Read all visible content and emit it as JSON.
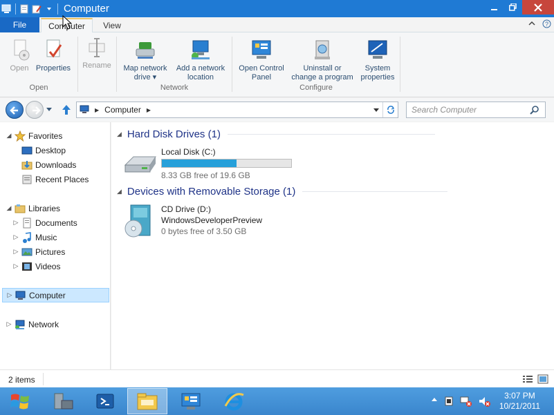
{
  "window": {
    "title": "Computer"
  },
  "tabs": {
    "file": "File",
    "computer": "Computer",
    "view": "View"
  },
  "ribbon": {
    "open": "Open",
    "properties": "Properties",
    "rename": "Rename",
    "map_drive_line1": "Map network",
    "map_drive_line2": "drive ▾",
    "add_location_line1": "Add a network",
    "add_location_line2": "location",
    "control_panel_line1": "Open Control",
    "control_panel_line2": "Panel",
    "uninstall_line1": "Uninstall or",
    "uninstall_line2": "change a program",
    "system_props_line1": "System",
    "system_props_line2": "properties",
    "group_open": "Open",
    "group_network": "Network",
    "group_configure": "Configure"
  },
  "address": {
    "crumb": "Computer",
    "search_placeholder": "Search Computer"
  },
  "nav": {
    "favorites": "Favorites",
    "desktop": "Desktop",
    "downloads": "Downloads",
    "recent": "Recent Places",
    "libraries": "Libraries",
    "documents": "Documents",
    "music": "Music",
    "pictures": "Pictures",
    "videos": "Videos",
    "computer": "Computer",
    "network": "Network"
  },
  "content": {
    "hdd_group": "Hard Disk Drives (1)",
    "removable_group": "Devices with Removable Storage (1)",
    "local_disk": {
      "name": "Local Disk (C:)",
      "free": "8.33 GB free of 19.6 GB",
      "used_fraction": 0.575
    },
    "cd_drive": {
      "name": "CD Drive (D:)",
      "label": "WindowsDeveloperPreview",
      "free": "0 bytes free of 3.50 GB"
    }
  },
  "status": {
    "items": "2 items"
  },
  "taskbar": {
    "time": "3:07 PM",
    "date": "10/21/2011"
  },
  "colors": {
    "titlebar": "#1f7ad4",
    "file_tab": "#1969c5",
    "accent_blue": "#26a0da",
    "group_header": "#1e3287"
  }
}
